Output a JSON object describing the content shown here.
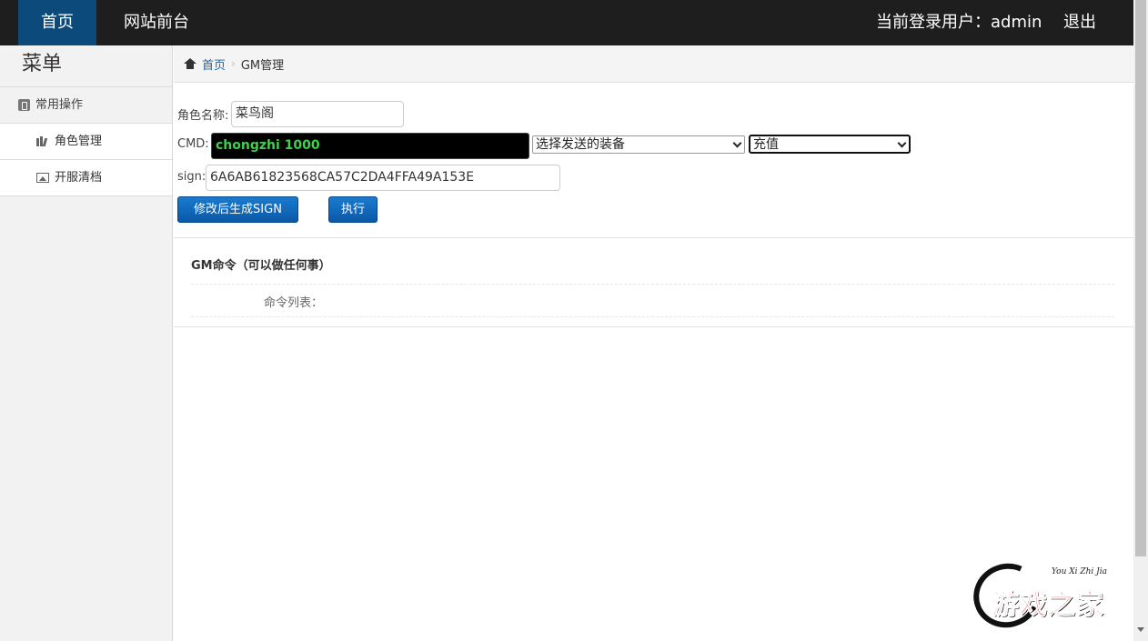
{
  "topbar": {
    "home_label": "首页",
    "front_label": "网站前台",
    "user_label": "当前登录用户：admin",
    "logout_label": "退出"
  },
  "sidebar": {
    "title": "菜单",
    "group_label": "常用操作",
    "items": [
      {
        "label": "角色管理",
        "icon": "books-icon"
      },
      {
        "label": "开服清档",
        "icon": "image-icon"
      }
    ]
  },
  "breadcrumb": {
    "home": "首页",
    "current": "GM管理"
  },
  "form": {
    "role_label": "角色名称:",
    "role_value": "菜鸟阁",
    "cmd_label": "CMD:",
    "cmd_value": "chongzhi 1000",
    "equip_select": "选择发送的装备",
    "type_select": "充值",
    "sign_label": "sign:",
    "sign_value": "6A6AB61823568CA57C2DA4FFA49A153E",
    "gen_sign_button": "修改后生成SIGN",
    "execute_button": "执行"
  },
  "gm_section": {
    "title": "GM命令（可以做任何事）",
    "list_label": "命令列表："
  },
  "watermark": {
    "pinyin": "You Xi Zhi Jia",
    "text": "游戏之家"
  },
  "colors": {
    "topbar_bg": "#1e1e1e",
    "active_nav": "#0d4a7c",
    "button_blue": "#0a58a6",
    "cmd_text": "#3fd14a"
  }
}
